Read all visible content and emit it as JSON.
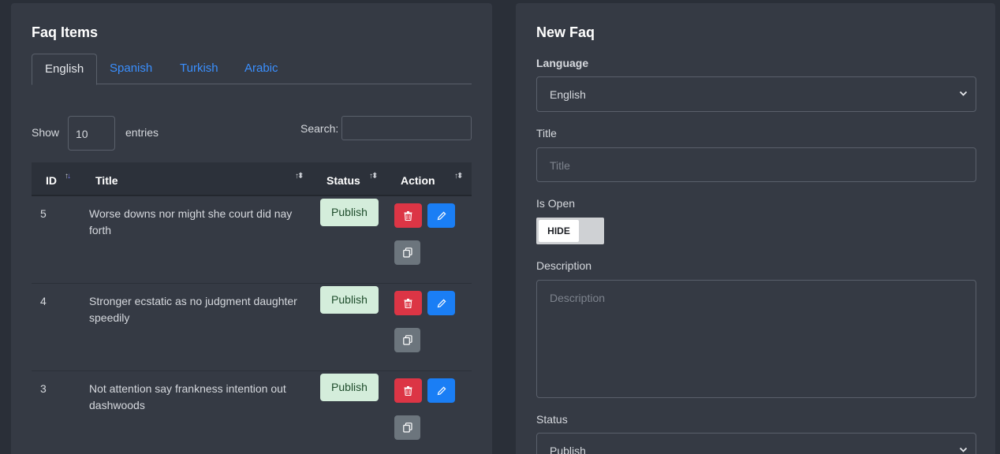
{
  "faq_items": {
    "title": "Faq Items",
    "tabs": [
      "English",
      "Spanish",
      "Turkish",
      "Arabic"
    ],
    "show_label": "Show",
    "show_value": "10",
    "entries_label": "entries",
    "search_label": "Search:",
    "columns": [
      "ID",
      "Title",
      "Status",
      "Action"
    ],
    "rows": [
      {
        "id": "5",
        "title": "Worse downs nor might she court did nay forth",
        "status": "Publish"
      },
      {
        "id": "4",
        "title": "Stronger ecstatic as no judgment daughter speedily",
        "status": "Publish"
      },
      {
        "id": "3",
        "title": "Not attention say frankness intention out dashwoods",
        "status": "Publish"
      }
    ]
  },
  "new_faq": {
    "title": "New Faq",
    "language_label": "Language",
    "language_value": "English",
    "title_label": "Title",
    "title_placeholder": "Title",
    "is_open_label": "Is Open",
    "toggle_label": "HIDE",
    "description_label": "Description",
    "description_placeholder": "Description",
    "status_label": "Status",
    "status_value": "Publish"
  },
  "colors": {
    "delete": "#dc3545",
    "edit": "#1a7ef5",
    "copy": "#6c757d",
    "publish_badge": "#d4eddb",
    "tab_link": "#3a8ffe"
  },
  "icons": [
    "trash-icon",
    "pencil-icon",
    "copy-icon",
    "sort-icon",
    "chevron-down-icon"
  ]
}
